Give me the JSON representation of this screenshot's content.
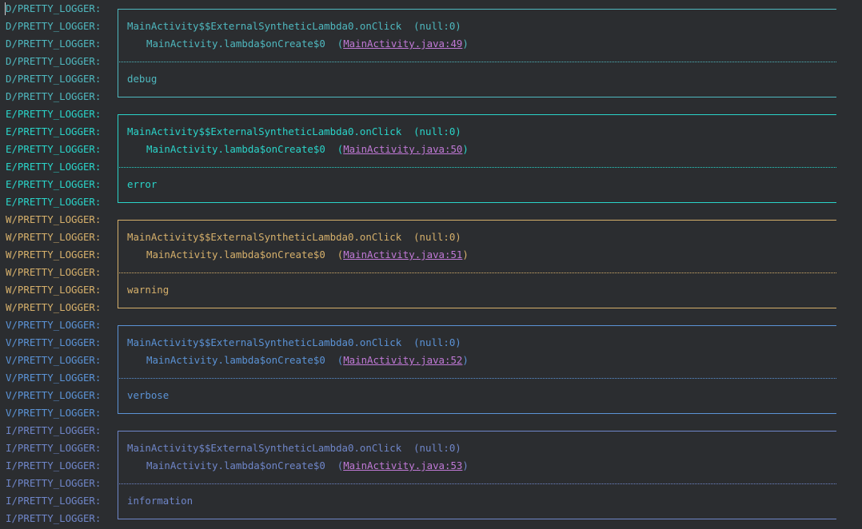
{
  "colors": {
    "D": "#4fb8bf",
    "E": "#2ad4c9",
    "W": "#d6b06b",
    "V": "#5b93d6",
    "I": "#6f86c9",
    "link": "#c079d6",
    "background": "#2b2d30"
  },
  "blocks": [
    {
      "level": "D",
      "tag": "D/PRETTY_LOGGER:",
      "method": "MainActivity$$ExternalSyntheticLambda0.onClick",
      "method_loc": "(null:0)",
      "caller": "MainActivity.lambda$onCreate$0",
      "caller_link": "MainActivity.java:49",
      "message": "debug"
    },
    {
      "level": "E",
      "tag": "E/PRETTY_LOGGER:",
      "method": "MainActivity$$ExternalSyntheticLambda0.onClick",
      "method_loc": "(null:0)",
      "caller": "MainActivity.lambda$onCreate$0",
      "caller_link": "MainActivity.java:50",
      "message": "error"
    },
    {
      "level": "W",
      "tag": "W/PRETTY_LOGGER:",
      "method": "MainActivity$$ExternalSyntheticLambda0.onClick",
      "method_loc": "(null:0)",
      "caller": "MainActivity.lambda$onCreate$0",
      "caller_link": "MainActivity.java:51",
      "message": "warning"
    },
    {
      "level": "V",
      "tag": "V/PRETTY_LOGGER:",
      "method": "MainActivity$$ExternalSyntheticLambda0.onClick",
      "method_loc": "(null:0)",
      "caller": "MainActivity.lambda$onCreate$0",
      "caller_link": "MainActivity.java:52",
      "message": "verbose"
    },
    {
      "level": "I",
      "tag": "I/PRETTY_LOGGER:",
      "method": "MainActivity$$ExternalSyntheticLambda0.onClick",
      "method_loc": "(null:0)",
      "caller": "MainActivity.lambda$onCreate$0",
      "caller_link": "MainActivity.java:53",
      "message": "information"
    }
  ]
}
